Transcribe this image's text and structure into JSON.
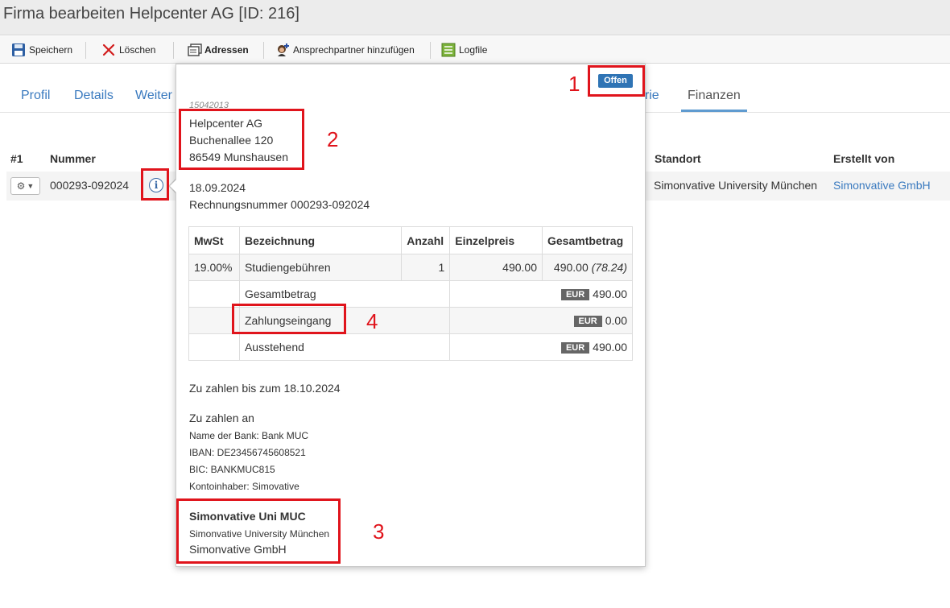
{
  "window": {
    "title": "Firma bearbeiten Helpcenter AG [ID: 216]"
  },
  "toolbar": {
    "save_label": "Speichern",
    "delete_label": "Löschen",
    "addresses_label": "Adressen",
    "add_contact_label": "Ansprechpartner hinzufügen",
    "logfile_label": "Logfile"
  },
  "tabs": {
    "profil": "Profil",
    "details": "Details",
    "weitere": "Weiter",
    "kategorie": "orie",
    "finanzen": "Finanzen"
  },
  "table": {
    "headers": {
      "index": "#1",
      "nummer": "Nummer",
      "standort": "Standort",
      "erstellt_von": "Erstellt von"
    },
    "row": {
      "nummer": "000293-092024",
      "standort": "Simonvative University München",
      "erstellt_von": "Simonvative GmbH"
    }
  },
  "popover": {
    "status": "Offen",
    "faded_id": "15042013",
    "recipient": {
      "name": "Helpcenter AG",
      "street": "Buchenallee 120",
      "city": "86549 Munshausen"
    },
    "date": "18.09.2024",
    "invoice_number": "Rechnungsnummer 000293-092024",
    "items_headers": {
      "vat": "MwSt",
      "description": "Bezeichnung",
      "quantity": "Anzahl",
      "unit_price": "Einzelpreis",
      "total": "Gesamtbetrag"
    },
    "items": [
      {
        "vat": "19.00%",
        "description": "Studiengebühren",
        "quantity": "1",
        "unit_price": "490.00",
        "total": "490.00",
        "tax": "(78.24)"
      }
    ],
    "summary": [
      {
        "label": "Gesamtbetrag",
        "currency": "EUR",
        "amount": "490.00"
      },
      {
        "label": "Zahlungseingang",
        "currency": "EUR",
        "amount": "0.00"
      },
      {
        "label": "Ausstehend",
        "currency": "EUR",
        "amount": "490.00"
      }
    ],
    "due": "Zu zahlen bis zum 18.10.2024",
    "pay_to": {
      "heading": "Zu zahlen an",
      "bank": "Name der Bank: Bank MUC",
      "iban": "IBAN: DE23456745608521",
      "bic": "BIC: BANKMUC815",
      "holder": "Kontoinhaber: Simovative"
    },
    "issuer": {
      "name": "Simonvative Uni MUC",
      "location": "Simonvative University München",
      "company": "Simonvative GmbH"
    }
  },
  "annotations": {
    "n1": "1",
    "n2": "2",
    "n3": "3",
    "n4": "4"
  },
  "colors": {
    "accent": "#3a7abf",
    "badge": "#2f74b5",
    "highlight": "#e0141c"
  }
}
